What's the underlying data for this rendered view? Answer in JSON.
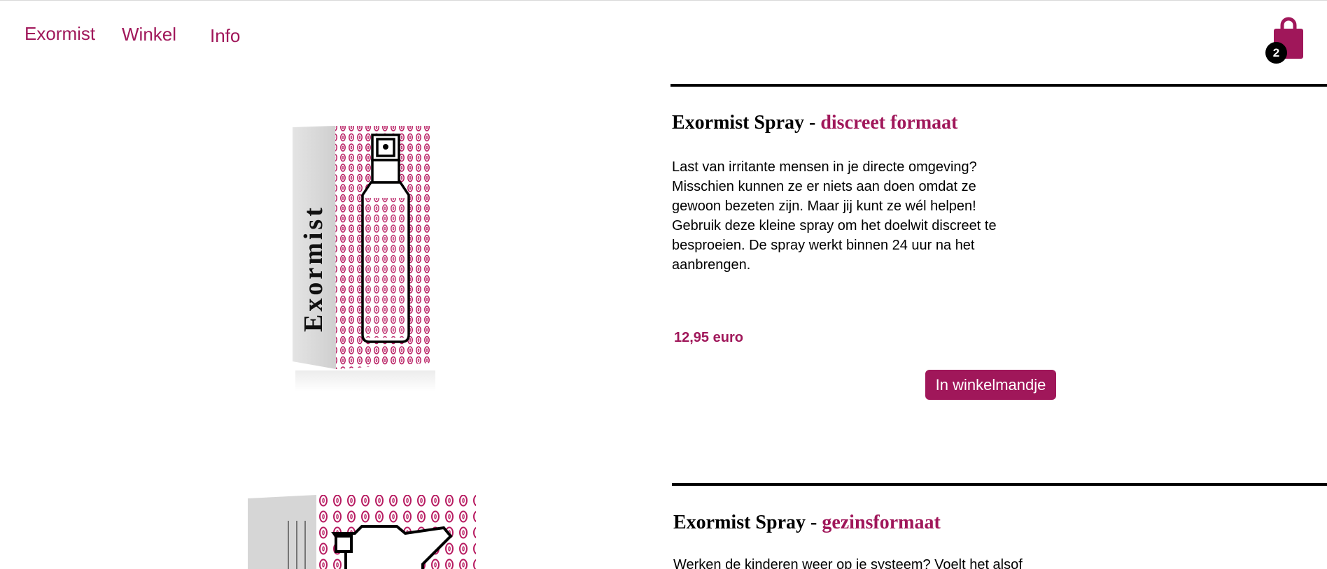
{
  "nav": {
    "items": [
      "Exormist",
      "Winkel",
      "Info"
    ]
  },
  "cart": {
    "count": "2",
    "icon": "shopping-bag-icon"
  },
  "colors": {
    "accent": "#a0175a",
    "text": "#000000",
    "background": "#ffffff"
  },
  "products": [
    {
      "title_main": "Exormist Spray - ",
      "title_accent": "discreet formaat",
      "description": "Last van irritante mensen in je directe omgeving? Misschien kunnen ze er  niets aan doen omdat ze gewoon bezeten zijn. Maar jij kunt ze wél helpen! Gebruik deze kleine spray om het doelwit discreet te besproeien. De spray werkt binnen 24 uur na het aanbrengen.",
      "price": "12,95 euro",
      "button_label": "In winkelmandje",
      "box_text": "Exormist"
    },
    {
      "title_main": "Exormist Spray - ",
      "title_accent": "gezinsformaat",
      "description": "Werken de kinderen weer op je systeem? Voelt het alsof"
    }
  ]
}
